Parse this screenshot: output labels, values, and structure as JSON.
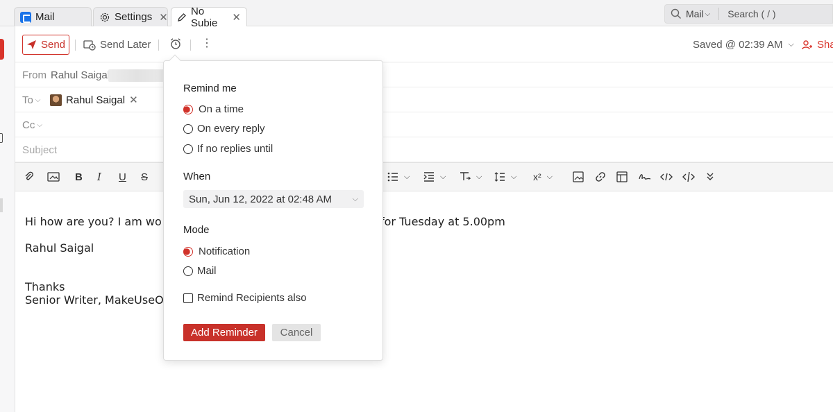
{
  "tabs": [
    {
      "label": "Mail",
      "icon": "mail-app-icon"
    },
    {
      "label": "Settings",
      "icon": "gear-icon"
    },
    {
      "label": "No Subje",
      "icon": "pencil-icon"
    }
  ],
  "search": {
    "scope": "Mail",
    "placeholder": "Search ( / )"
  },
  "toolbar": {
    "send_label": "Send",
    "send_later_label": "Send Later",
    "saved_status": "Saved @ 02:39 AM",
    "share_label": "Sha"
  },
  "fields": {
    "from_label": "From",
    "from_name": "Rahul Saigal",
    "to_label": "To",
    "to_recipient": "Rahul Saigal",
    "cc_label": "Cc",
    "subject_placeholder": "Subject"
  },
  "body": {
    "line1_start": "Hi how are you? I am wo",
    "line1_end": "for Tuesday at 5.00pm",
    "line2": "Rahul Saigal",
    "line3": "Thanks",
    "line4": "Senior Writer, MakeUseO"
  },
  "reminder": {
    "remind_me_heading": "Remind me",
    "remind_options": [
      "On a time",
      "On every reply",
      "If no replies until"
    ],
    "remind_selected": 0,
    "when_heading": "When",
    "when_value": "Sun, Jun 12, 2022 at 02:48 AM",
    "mode_heading": "Mode",
    "mode_options": [
      "Notification",
      "Mail"
    ],
    "mode_selected": 0,
    "recipients_label": "Remind Recipients also",
    "recipients_checked": false,
    "add_label": "Add Reminder",
    "cancel_label": "Cancel"
  },
  "colors": {
    "accent": "#c8312a",
    "tab_bar": "#f3f3f4",
    "format_bar": "#f5f5f5"
  }
}
